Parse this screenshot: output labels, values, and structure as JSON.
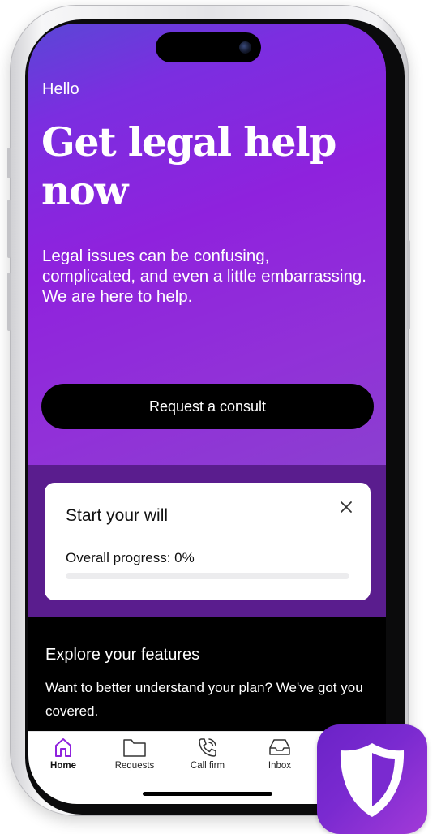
{
  "hero": {
    "greeting": "Hello",
    "headline": "Get legal help now",
    "subtitle": "Legal issues can be confusing, complicated, and even a little embarrassing. We are here to help.",
    "cta_label": "Request a consult"
  },
  "will_card": {
    "title": "Start your will",
    "progress_label": "Overall progress: 0%",
    "progress_value": 0
  },
  "explore": {
    "title": "Explore your features",
    "description": "Want to better understand your plan? We've got you covered."
  },
  "tabbar": {
    "home": "Home",
    "requests": "Requests",
    "call_firm": "Call firm",
    "inbox": "Inbox"
  },
  "colors": {
    "accent": "#8f22dd",
    "section_bg": "#5a1d8e",
    "app_icon": "#7a2ad0"
  },
  "icons": {
    "home": "home-icon",
    "requests": "folder-icon",
    "call_firm": "phone-icon",
    "inbox": "inbox-icon",
    "close": "close-icon",
    "app": "shield-icon"
  }
}
